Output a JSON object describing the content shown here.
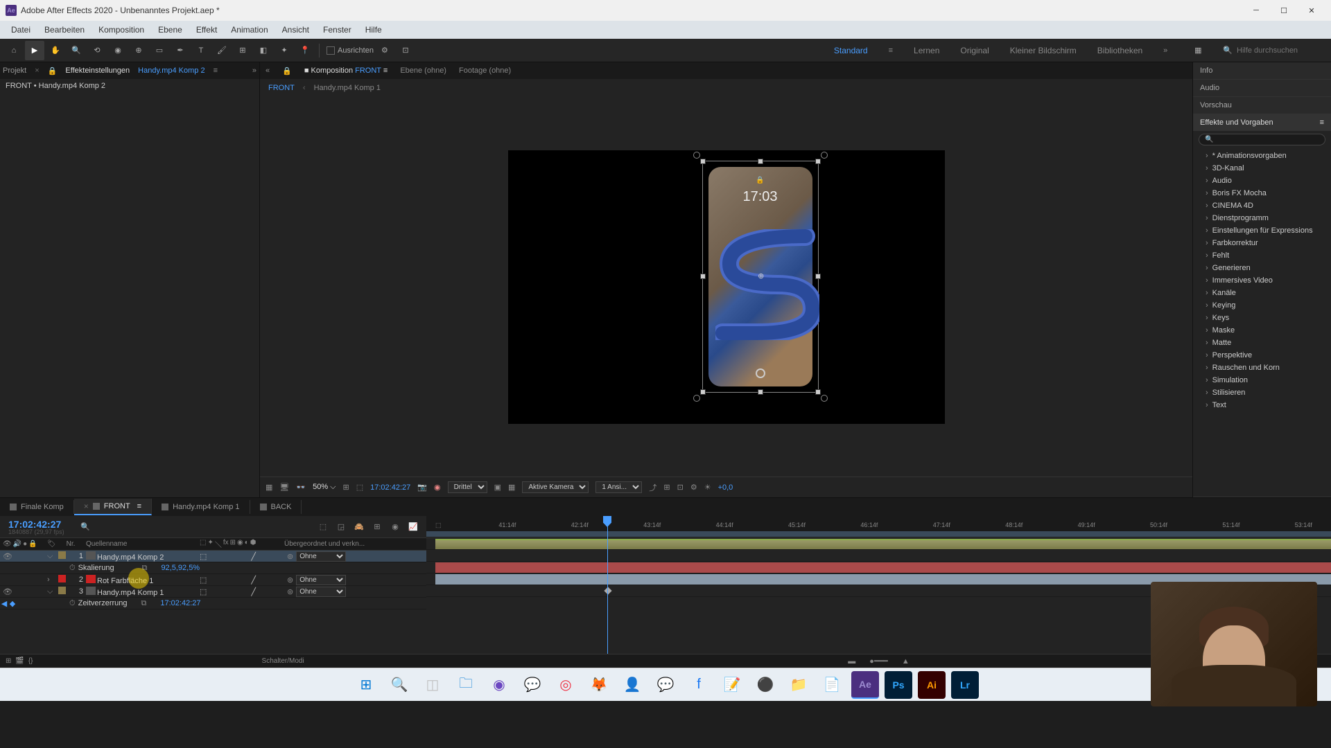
{
  "app": {
    "title": "Adobe After Effects 2020 - Unbenanntes Projekt.aep *",
    "logo": "Ae"
  },
  "menu": [
    "Datei",
    "Bearbeiten",
    "Komposition",
    "Ebene",
    "Effekt",
    "Animation",
    "Ansicht",
    "Fenster",
    "Hilfe"
  ],
  "toolbar": {
    "ausrichten": "Ausrichten",
    "search_placeholder": "Hilfe durchsuchen",
    "workspaces": [
      "Standard",
      "Lernen",
      "Original",
      "Kleiner Bildschirm",
      "Bibliotheken"
    ]
  },
  "project_panel": {
    "tab1": "Projekt",
    "tab2": "Effekteinstellungen",
    "tab2_val": "Handy.mp4 Komp 2",
    "breadcrumb": "FRONT • Handy.mp4 Komp 2"
  },
  "comp_panel": {
    "tab_comp": "Komposition",
    "tab_comp_val": "FRONT",
    "tab_layer": "Ebene (ohne)",
    "tab_footage": "Footage (ohne)",
    "nav_front": "FRONT",
    "nav_comp": "Handy.mp4 Komp 1",
    "phone_time": "17:03"
  },
  "viewer": {
    "zoom": "50%",
    "timecode": "17:02:42:27",
    "res": "Drittel",
    "camera": "Aktive Kamera",
    "views": "1 Ansi...",
    "exposure": "+0,0"
  },
  "right_panel": {
    "info": "Info",
    "audio": "Audio",
    "vorschau": "Vorschau",
    "effects_title": "Effekte und Vorgaben",
    "categories": [
      "* Animationsvorgaben",
      "3D-Kanal",
      "Audio",
      "Boris FX Mocha",
      "CINEMA 4D",
      "Dienstprogramm",
      "Einstellungen für Expressions",
      "Farbkorrektur",
      "Fehlt",
      "Generieren",
      "Immersives Video",
      "Kanäle",
      "Keying",
      "Keys",
      "Maske",
      "Matte",
      "Perspektive",
      "Rauschen und Korn",
      "Simulation",
      "Stilisieren",
      "Text"
    ]
  },
  "timeline": {
    "tabs": [
      {
        "name": "Finale Komp"
      },
      {
        "name": "FRONT",
        "active": true
      },
      {
        "name": "Handy.mp4 Komp 1"
      },
      {
        "name": "BACK"
      }
    ],
    "timecode": "17:02:42:27",
    "fps": "1840887 (29,97 fps)",
    "col_nr": "Nr.",
    "col_name": "Quellenname",
    "col_parent": "Übergeordnet und verkn...",
    "ticks": [
      "41:14f",
      "42:14f",
      "43:14f",
      "44:14f",
      "45:14f",
      "46:14f",
      "47:14f",
      "48:14f",
      "49:14f",
      "50:14f",
      "51:14f",
      "53:14f"
    ],
    "layers": [
      {
        "nr": "1",
        "name": "Handy.mp4 Komp 2",
        "parent": "Ohne",
        "selected": true,
        "color": "#8a7a48"
      },
      {
        "prop": "Skalierung",
        "val": "92,5,92,5%"
      },
      {
        "nr": "2",
        "name": "Rot Farbfläche 1",
        "parent": "Ohne",
        "color": "#cc2222"
      },
      {
        "nr": "3",
        "name": "Handy.mp4 Komp 1",
        "parent": "Ohne",
        "color": "#8a7a48"
      },
      {
        "prop": "Zeitverzerrung",
        "val": "17:02:42:27"
      }
    ],
    "footer": "Schalter/Modi"
  }
}
